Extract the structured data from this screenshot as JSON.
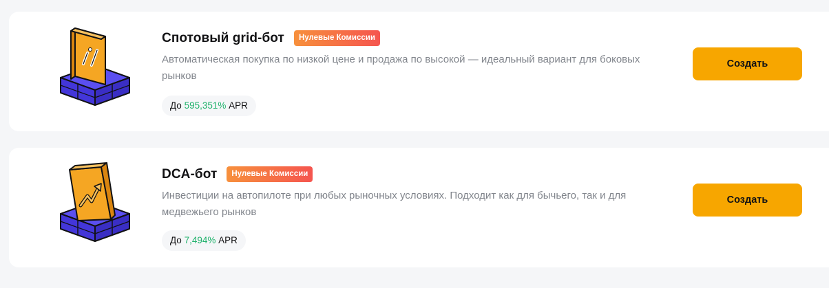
{
  "bots": [
    {
      "title": "Спотовый grid-бот",
      "badge": "Нулевые Комиссии",
      "description": "Автоматическая покупка по низкой цене и продажа по высокой — идеальный вариант для боковых рынков",
      "apr_prefix": "До",
      "apr_value": "595,351%",
      "apr_suffix": "APR",
      "button_label": "Создать",
      "icon": "grid-bot-illustration"
    },
    {
      "title": "DCA-бот",
      "badge": "Нулевые Комиссии",
      "description": "Инвестиции на автопилоте при любых рыночных условиях. Подходит как для бычьего, так и для медвежьего рынков",
      "apr_prefix": "До",
      "apr_value": "7,494%",
      "apr_suffix": "APR",
      "button_label": "Создать",
      "icon": "dca-bot-illustration"
    }
  ],
  "colors": {
    "page_bg": "#f5f6f8",
    "card_bg": "#ffffff",
    "button": "#f7a600",
    "badge_start": "#f7903c",
    "badge_end": "#f5554f",
    "apr_value": "#20b26c",
    "illustration_base": "#4b3ee6",
    "illustration_card": "#f5a623"
  }
}
